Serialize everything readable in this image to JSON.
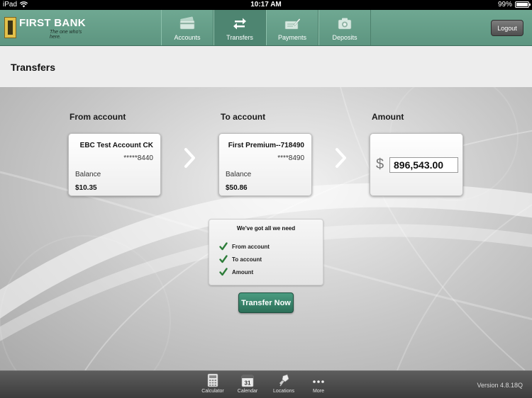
{
  "status_bar": {
    "device": "iPad",
    "time": "10:17 AM",
    "battery": "99%",
    "battery_level": 0.99
  },
  "brand": {
    "name": "FIRST BANK",
    "tagline": "The one who's here."
  },
  "nav": {
    "tabs": [
      {
        "label": "Accounts",
        "icon": "accounts-card-icon",
        "active": false
      },
      {
        "label": "Transfers",
        "icon": "transfer-arrows-icon",
        "active": true
      },
      {
        "label": "Payments",
        "icon": "payments-icon",
        "active": false
      },
      {
        "label": "Deposits",
        "icon": "camera-icon",
        "active": false
      }
    ],
    "logout_label": "Logout"
  },
  "page": {
    "title": "Transfers"
  },
  "from_account": {
    "section_label": "From account",
    "name": "EBC Test Account CK",
    "number": "*****8440",
    "balance_label": "Balance",
    "balance": "$10.35"
  },
  "to_account": {
    "section_label": "To account",
    "name": "First Premium--718490",
    "number": "****8490",
    "balance_label": "Balance",
    "balance": "$50.86"
  },
  "amount": {
    "section_label": "Amount",
    "currency_symbol": "$",
    "value": "896,543.00"
  },
  "checklist": {
    "title": "We've got all we need",
    "items": [
      "From account",
      "To account",
      "Amount"
    ]
  },
  "transfer_button_label": "Transfer Now",
  "toolbar": {
    "items": [
      {
        "label": "Calculator",
        "icon": "calculator-icon"
      },
      {
        "label": "Calendar",
        "icon": "calendar-icon",
        "day": "31"
      },
      {
        "label": "Locations",
        "icon": "location-pin-icon"
      },
      {
        "label": "More",
        "icon": "more-dots-icon"
      }
    ],
    "version": "Version 4.8.18Q"
  },
  "colors": {
    "header_green": "#5d9580",
    "button_green": "#2c6f58",
    "check_green": "#2e7d3a"
  }
}
